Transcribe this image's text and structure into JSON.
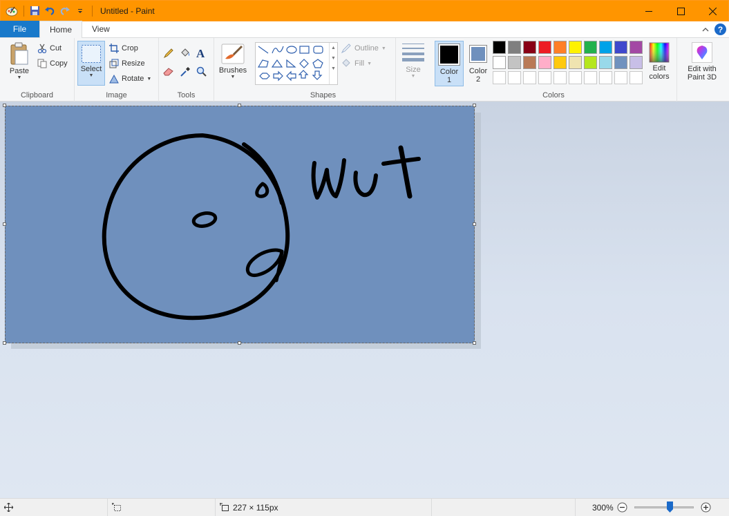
{
  "window": {
    "title": "Untitled - Paint"
  },
  "tabs": {
    "file": "File",
    "home": "Home",
    "view": "View"
  },
  "clipboard": {
    "paste": "Paste",
    "cut": "Cut",
    "copy": "Copy",
    "label": "Clipboard"
  },
  "image": {
    "select": "Select",
    "crop": "Crop",
    "resize": "Resize",
    "rotate": "Rotate",
    "label": "Image"
  },
  "tools": {
    "label": "Tools"
  },
  "brushes": {
    "label": "Brushes"
  },
  "shapes": {
    "outline": "Outline",
    "fill": "Fill",
    "label": "Shapes"
  },
  "size": {
    "label": "Size"
  },
  "colors": {
    "color1_label": "Color",
    "color1_num": "1",
    "color2_label": "Color",
    "color2_num": "2",
    "color1_value": "#000000",
    "color2_value": "#6f90bd",
    "edit_line1": "Edit",
    "edit_line2": "colors",
    "label": "Colors",
    "palette_row1": [
      "#000000",
      "#7f7f7f",
      "#880015",
      "#ed1c24",
      "#ff7f27",
      "#fff200",
      "#22b14c",
      "#00a2e8",
      "#3f48cc",
      "#a349a4"
    ],
    "palette_row2": [
      "#ffffff",
      "#c3c3c3",
      "#b97a57",
      "#ffaec9",
      "#ffc90e",
      "#efe4b0",
      "#b5e61d",
      "#99d9ea",
      "#7092be",
      "#c8bfe7"
    ],
    "palette_row3": [
      "#ffffff",
      "#ffffff",
      "#ffffff",
      "#ffffff",
      "#ffffff",
      "#ffffff",
      "#ffffff",
      "#ffffff",
      "#ffffff",
      "#ffffff"
    ]
  },
  "paint3d": {
    "line1": "Edit with",
    "line2": "Paint 3D"
  },
  "canvas": {
    "background": "#6f90bd",
    "drawn_text": "wut"
  },
  "status": {
    "dimensions": "227 × 115px",
    "zoom": "300%"
  }
}
